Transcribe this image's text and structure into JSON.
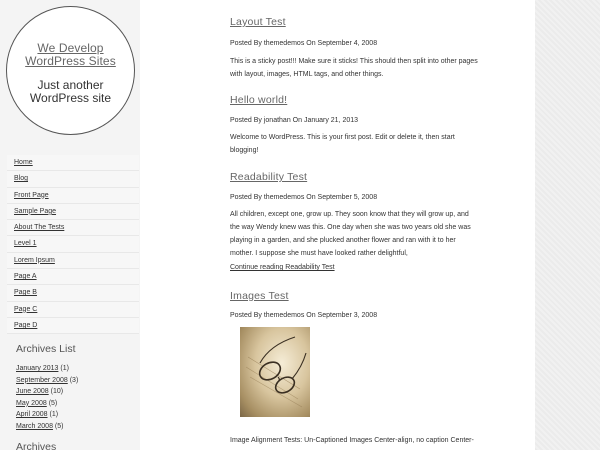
{
  "site": {
    "title": "We Develop WordPress Sites",
    "tagline": "Just another WordPress site"
  },
  "nav": {
    "items": [
      {
        "label": "Home"
      },
      {
        "label": "Blog"
      },
      {
        "label": "Front Page"
      },
      {
        "label": "Sample Page"
      },
      {
        "label": "About The Tests"
      },
      {
        "label": "Level 1"
      },
      {
        "label": "Lorem Ipsum"
      },
      {
        "label": "Page A"
      },
      {
        "label": "Page B"
      },
      {
        "label": "Page C"
      },
      {
        "label": "Page D"
      }
    ]
  },
  "archives_list": {
    "title": "Archives List",
    "items": [
      {
        "label": "January 2013",
        "count": "(1)"
      },
      {
        "label": "September 2008",
        "count": "(3)"
      },
      {
        "label": "June 2008",
        "count": "(10)"
      },
      {
        "label": "May 2008",
        "count": "(5)"
      },
      {
        "label": "April 2008",
        "count": "(1)"
      },
      {
        "label": "March 2008",
        "count": "(5)"
      }
    ]
  },
  "archives2": {
    "title": "Archives"
  },
  "posts": [
    {
      "title": "Layout Test",
      "meta": "Posted By themedemos On September 4, 2008",
      "excerpt": "This is a sticky post!!! Make sure it sticks! This should then split into other pages with layout, images, HTML tags, and other things."
    },
    {
      "title": "Hello world!",
      "meta": "Posted By jonathan On January 21, 2013",
      "excerpt": "Welcome to WordPress. This is your first post. Edit or delete it, then start blogging!"
    },
    {
      "title": "Readability Test",
      "meta": "Posted By themedemos On September 5, 2008",
      "excerpt": "All children, except one, grow up. They soon know that they will grow up, and the way Wendy knew was this. One day when she was two years old she was playing in a garden, and she plucked another flower and ran with it to her mother. I suppose she must have looked rather delightful,",
      "more": "Continue reading Readability Test"
    },
    {
      "title": "Images Test",
      "meta": "Posted By themedemos On September 3, 2008",
      "excerpt": "Image Alignment Tests: Un-Captioned Images Center-align, no caption Center-"
    }
  ]
}
